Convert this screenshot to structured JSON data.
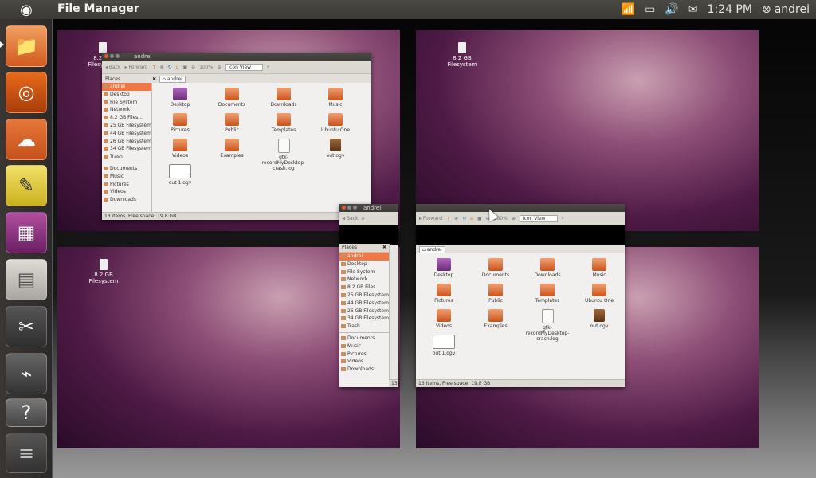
{
  "topbar": {
    "app_title": "File Manager",
    "clock": "1:24 PM",
    "user": "andrei"
  },
  "icons": {
    "ubuntu": "ubuntu-logo-icon",
    "wifi": "wifi-icon",
    "battery": "battery-icon",
    "volume": "volume-icon",
    "mail": "mail-icon",
    "session": "session-icon"
  },
  "launcher": [
    "home-folder",
    "firefox",
    "ubuntu-one",
    "text-editor",
    "workspaces",
    "file-manager",
    "screenshot-tool",
    "usb-drive",
    "help",
    "more-apps"
  ],
  "desktop_icon_label": "8.2 GB Filesystem",
  "window": {
    "title": "andrei",
    "back": "Back",
    "forward": "Forward",
    "zoom": "100%",
    "view_mode": "Icon View",
    "path_tab": "andrei",
    "places_label": "Places",
    "places": [
      "andrei",
      "Desktop",
      "File System",
      "Network",
      "8.2 GB Files...",
      "25 GB Filesystem",
      "44 GB Filesystem",
      "26 GB Filesystem",
      "34 GB Filesystem",
      "Trash"
    ],
    "bookmarks": [
      "Documents",
      "Music",
      "Pictures",
      "Videos",
      "Downloads"
    ],
    "files": [
      {
        "name": "Desktop",
        "kind": "purple"
      },
      {
        "name": "Documents",
        "kind": "folder"
      },
      {
        "name": "Downloads",
        "kind": "folder"
      },
      {
        "name": "Music",
        "kind": "folder"
      },
      {
        "name": "Pictures",
        "kind": "folder"
      },
      {
        "name": "Public",
        "kind": "folder"
      },
      {
        "name": "Templates",
        "kind": "folder"
      },
      {
        "name": "Ubuntu One",
        "kind": "folder"
      },
      {
        "name": "Videos",
        "kind": "folder"
      },
      {
        "name": "Examples",
        "kind": "folder"
      },
      {
        "name": "gtk-recordMyDesktop-crash.log",
        "kind": "doc"
      },
      {
        "name": "out.ogv",
        "kind": "vid"
      },
      {
        "name": "out 1.ogv",
        "kind": "thumb"
      }
    ],
    "status": "13 items, Free space: 19.8 GB",
    "status_short": "13"
  }
}
